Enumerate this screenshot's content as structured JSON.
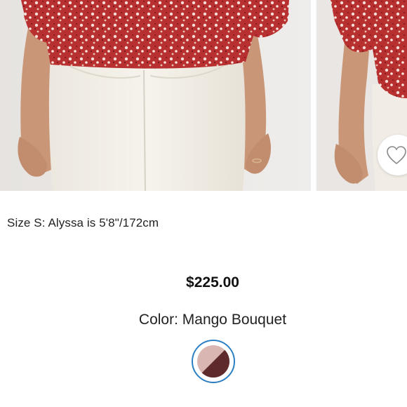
{
  "product": {
    "size_note": "Size S: Alyssa is 5'8\"/172cm",
    "price": "$225.00",
    "color_label": "Color: Mango Bouquet"
  },
  "gallery": {
    "images": [
      {
        "alt": "Model wearing red floral blouse with white jeans, front view"
      },
      {
        "alt": "Model wearing red floral blouse, side view"
      }
    ],
    "wishlist_icon": "heart-outline-icon"
  },
  "swatch": {
    "name": "Mango Bouquet",
    "colors": [
      "#5e2a2c",
      "#d9b6b1"
    ],
    "selected_ring": "#2d7fc4"
  }
}
